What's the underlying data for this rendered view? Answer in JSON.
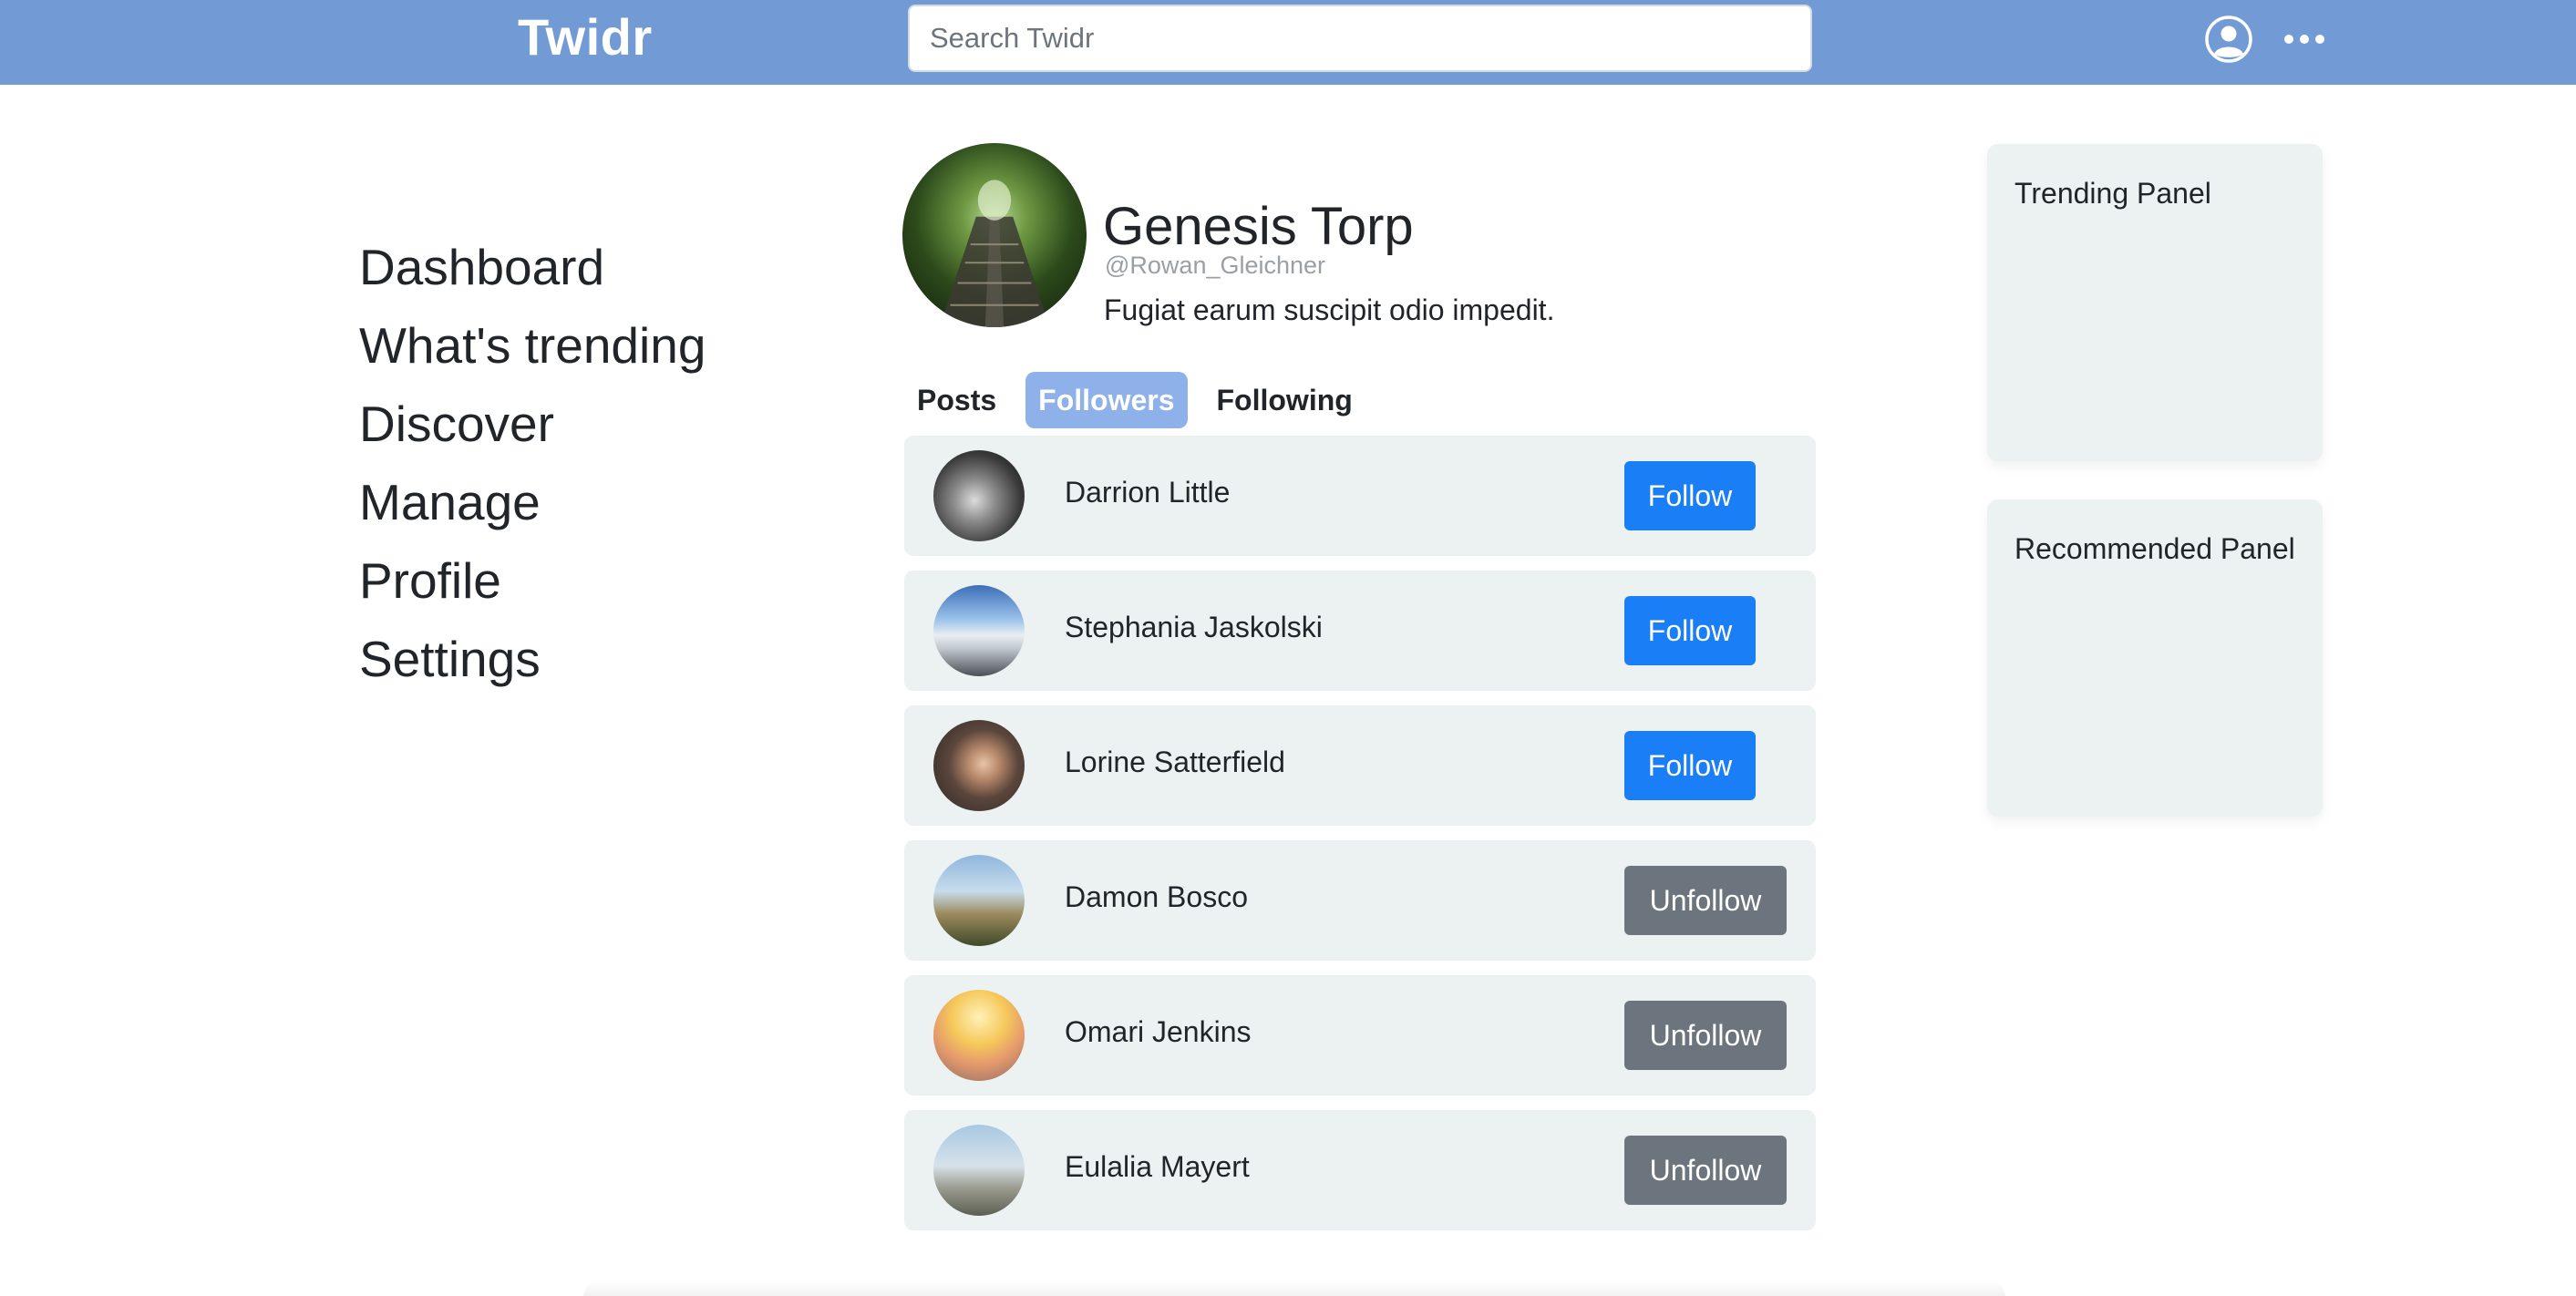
{
  "app": {
    "brand": "Twidr",
    "search": {
      "placeholder": "Search Twidr",
      "value": ""
    },
    "icons": {
      "account": "account-circle-icon",
      "more": "more-horizontal-icon"
    },
    "colors": {
      "topbar": "#729bd6",
      "primary": "#1a7ff6",
      "secondary": "#6c757d",
      "active_tab": "#8fb1ea",
      "card_bg": "#ecf1f1"
    }
  },
  "sidebar": {
    "items": [
      {
        "label": "Dashboard"
      },
      {
        "label": "What's trending"
      },
      {
        "label": "Discover"
      },
      {
        "label": "Manage"
      },
      {
        "label": "Profile"
      },
      {
        "label": "Settings"
      }
    ]
  },
  "profile": {
    "name": "Genesis Torp",
    "handle": "@Rowan_Gleichner",
    "bio": "Fugiat earum suscipit odio impedit."
  },
  "tabs": [
    {
      "label": "Posts",
      "active": false
    },
    {
      "label": "Followers",
      "active": true
    },
    {
      "label": "Following",
      "active": false
    }
  ],
  "followers": [
    {
      "name": "Darrion Little",
      "action": "Follow"
    },
    {
      "name": "Stephania Jaskolski",
      "action": "Follow"
    },
    {
      "name": "Lorine Satterfield",
      "action": "Follow"
    },
    {
      "name": "Damon Bosco",
      "action": "Unfollow"
    },
    {
      "name": "Omari Jenkins",
      "action": "Unfollow"
    },
    {
      "name": "Eulalia Mayert",
      "action": "Unfollow"
    }
  ],
  "panels": {
    "trending": {
      "title": "Trending Panel"
    },
    "recommended": {
      "title": "Recommended Panel"
    }
  }
}
